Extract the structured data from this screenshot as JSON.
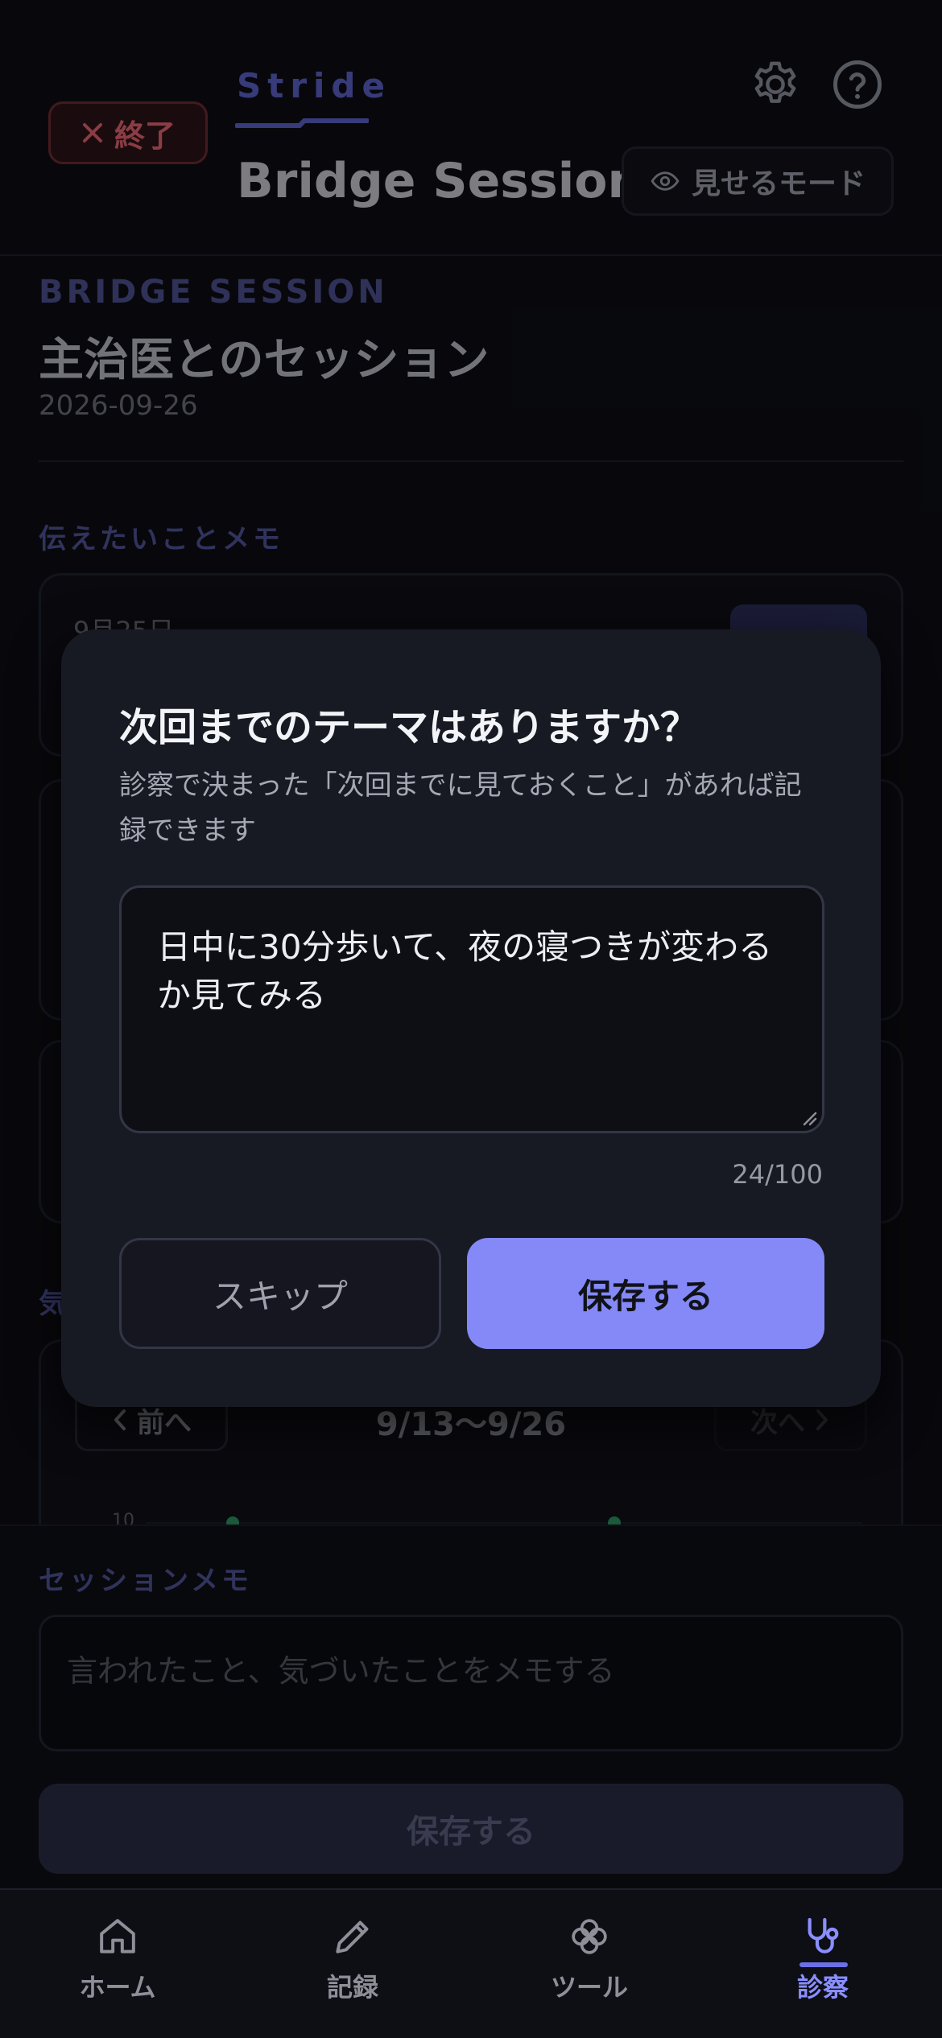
{
  "header": {
    "end_label": "終了",
    "brand": "Stride",
    "title": "Bridge Session",
    "show_mode_label": "見せるモード"
  },
  "session": {
    "eyebrow": "BRIDGE SESSION",
    "title": "主治医とのセッション",
    "date": "2026-09-26"
  },
  "memo_section": {
    "label": "伝えたいことメモ",
    "first_card_date": "9月25日"
  },
  "mood_section": {
    "label_partial": "気",
    "prev_label": "前へ",
    "next_label": "次へ",
    "range": "9/13〜9/26",
    "y_tick_top": "10"
  },
  "session_memo": {
    "label": "セッションメモ",
    "placeholder": "言われたこと、気づいたことをメモする",
    "save_label": "保存する"
  },
  "modal": {
    "title": "次回までのテーマはありますか？",
    "description": "診察で決まった「次回までに見ておくこと」があれば記録できます",
    "input_value": "日中に30分歩いて、夜の寝つきが変わるか見てみる",
    "char_count": "24/100",
    "skip_label": "スキップ",
    "save_label": "保存する"
  },
  "bottom_nav": {
    "items": [
      {
        "label": "ホーム",
        "icon": "home-icon"
      },
      {
        "label": "記録",
        "icon": "pencil-icon"
      },
      {
        "label": "ツール",
        "icon": "flower-icon"
      },
      {
        "label": "診察",
        "icon": "stethoscope-icon",
        "active": true
      }
    ]
  },
  "colors": {
    "accent": "#8489f7",
    "danger": "#e0626e",
    "background": "#0d0e14",
    "modal": "#181a23",
    "chart_dot": "#2e8f5e"
  }
}
